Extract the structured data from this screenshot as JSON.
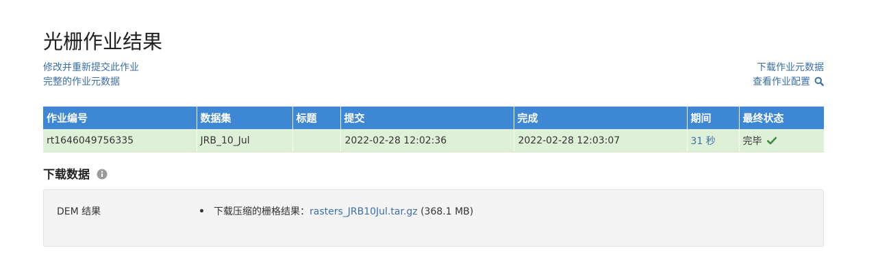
{
  "page": {
    "title": "光栅作业结果"
  },
  "links": {
    "modify_resubmit": "修改并重新提交此作业",
    "full_metadata": "完整的作业元数据",
    "download_metadata": "下载作业元数据",
    "view_config": "查看作业配置"
  },
  "icons": {
    "view_config_icon": "search-icon",
    "status_icon": "check-icon",
    "section_info_icon": "info-icon"
  },
  "colors": {
    "header_bg": "#3e87d4",
    "row_bg": "#dff0d8",
    "link": "#3a6fa8",
    "check": "#3c8a3c"
  },
  "table": {
    "headers": [
      "作业编号",
      "数据集",
      "标题",
      "提交",
      "完成",
      "期间",
      "最终状态"
    ],
    "row": {
      "job_id": "rt1646049756335",
      "dataset": "JRB_10_Jul",
      "title": "",
      "submitted": "2022-02-28 12:02:36",
      "completed": "2022-02-28 12:03:07",
      "duration": "31 秒",
      "status": "完毕"
    }
  },
  "download": {
    "heading": "下载数据",
    "item_label": "DEM 结果",
    "entry_prefix": "下载压缩的栅格结果：",
    "file_name": "rasters_JRB10Jul.tar.gz",
    "file_size": "(368.1 MB)"
  }
}
